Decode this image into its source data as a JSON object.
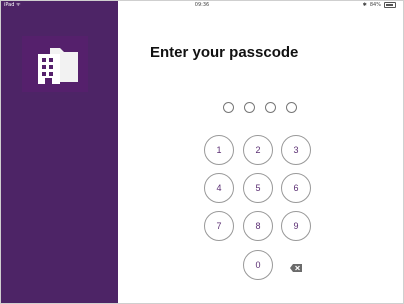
{
  "status_bar": {
    "device": "iPad ᯤ",
    "time": "09:36",
    "battery": "84%",
    "bluetooth": "bluetooth-icon"
  },
  "sidebar": {
    "logo": "building-folder-icon",
    "color": "#4d2466"
  },
  "passcode": {
    "title": "Enter your passcode",
    "entered_digits": 0,
    "length": 4
  },
  "keypad": {
    "k1": "1",
    "k2": "2",
    "k3": "3",
    "k4": "4",
    "k5": "5",
    "k6": "6",
    "k7": "7",
    "k8": "8",
    "k9": "9",
    "k0": "0",
    "delete": "delete-icon",
    "accent": "#5a2d72"
  }
}
